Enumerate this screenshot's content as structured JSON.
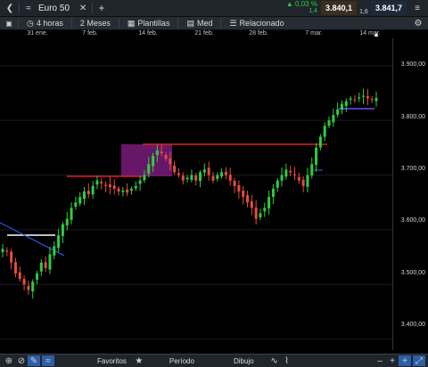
{
  "header": {
    "instrument": "Euro 50",
    "change_pct": "0,03 %",
    "change_abs": "1,4",
    "bid": "3.840,1",
    "spread": "1,6",
    "ask": "3.841,7"
  },
  "toolbar": {
    "interval": "4 horas",
    "range": "2 Meses",
    "templates": "Plantillas",
    "indicator": "Med",
    "related": "Relacionado"
  },
  "date_axis": [
    "31 ene.",
    "7 feb.",
    "14 feb.",
    "21 feb.",
    "28 feb.",
    "7 mar.",
    "14 mar."
  ],
  "price_axis": [
    "3.900,00",
    "3.800,00",
    "3.700,00",
    "3.600,00",
    "3.500,00",
    "3.400,00"
  ],
  "bottom": {
    "favorites": "Favoritos",
    "period": "Período",
    "drawing": "Dibujo"
  },
  "colors": {
    "up": "#2ecc40",
    "down": "#e74c3c",
    "support_line": "#e02020",
    "highlight": "#8a1f8a",
    "bid_box": "#3a2e1e",
    "ask_box": "#1e2a3a"
  },
  "chart_data": {
    "type": "candlestick",
    "y_range": [
      3380,
      3950
    ],
    "x_range": [
      "2020-01-28",
      "2020-03-17"
    ],
    "closes": [
      3565,
      3560,
      3540,
      3520,
      3510,
      3500,
      3490,
      3505,
      3520,
      3540,
      3530,
      3555,
      3570,
      3590,
      3610,
      3620,
      3640,
      3650,
      3660,
      3670,
      3665,
      3680,
      3690,
      3685,
      3680,
      3678,
      3675,
      3670,
      3672,
      3668,
      3675,
      3680,
      3690,
      3700,
      3720,
      3735,
      3745,
      3740,
      3730,
      3720,
      3705,
      3700,
      3690,
      3695,
      3700,
      3690,
      3705,
      3710,
      3700,
      3690,
      3700,
      3705,
      3700,
      3690,
      3680,
      3670,
      3660,
      3650,
      3640,
      3620,
      3630,
      3640,
      3660,
      3675,
      3690,
      3700,
      3710,
      3705,
      3700,
      3690,
      3680,
      3700,
      3720,
      3750,
      3770,
      3790,
      3800,
      3810,
      3820,
      3830,
      3835,
      3840,
      3838,
      3842,
      3845,
      3840,
      3838,
      3841
    ]
  }
}
